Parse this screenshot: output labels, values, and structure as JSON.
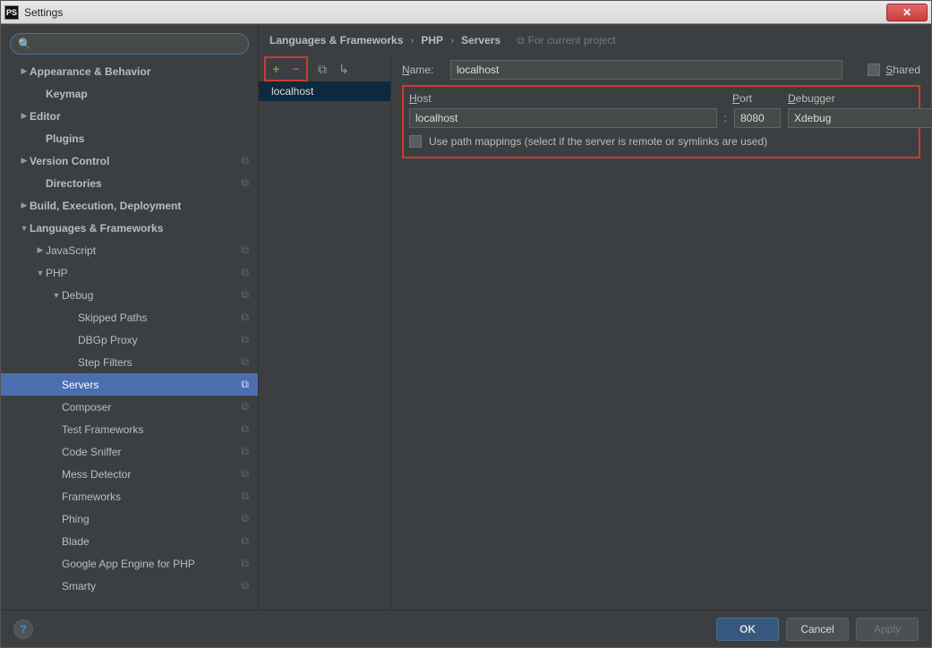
{
  "window": {
    "title": "Settings",
    "app_icon_text": "PS",
    "close_glyph": "✕"
  },
  "search": {
    "placeholder": ""
  },
  "sidebar": {
    "items": [
      {
        "label": "Appearance & Behavior",
        "bold": true,
        "depth": 0,
        "arrow": "right",
        "copy": false
      },
      {
        "label": "Keymap",
        "bold": true,
        "depth": 1,
        "arrow": "",
        "copy": false
      },
      {
        "label": "Editor",
        "bold": true,
        "depth": 0,
        "arrow": "right",
        "copy": false
      },
      {
        "label": "Plugins",
        "bold": true,
        "depth": 1,
        "arrow": "",
        "copy": false
      },
      {
        "label": "Version Control",
        "bold": true,
        "depth": 0,
        "arrow": "right",
        "copy": true
      },
      {
        "label": "Directories",
        "bold": true,
        "depth": 1,
        "arrow": "",
        "copy": true
      },
      {
        "label": "Build, Execution, Deployment",
        "bold": true,
        "depth": 0,
        "arrow": "right",
        "copy": false
      },
      {
        "label": "Languages & Frameworks",
        "bold": true,
        "depth": 0,
        "arrow": "down",
        "copy": false
      },
      {
        "label": "JavaScript",
        "bold": false,
        "depth": 1,
        "arrow": "right",
        "copy": true
      },
      {
        "label": "PHP",
        "bold": false,
        "depth": 1,
        "arrow": "down",
        "copy": true
      },
      {
        "label": "Debug",
        "bold": false,
        "depth": 2,
        "arrow": "down",
        "copy": true
      },
      {
        "label": "Skipped Paths",
        "bold": false,
        "depth": 3,
        "arrow": "",
        "copy": true
      },
      {
        "label": "DBGp Proxy",
        "bold": false,
        "depth": 3,
        "arrow": "",
        "copy": true
      },
      {
        "label": "Step Filters",
        "bold": false,
        "depth": 3,
        "arrow": "",
        "copy": true
      },
      {
        "label": "Servers",
        "bold": false,
        "depth": 2,
        "arrow": "",
        "copy": true,
        "selected": true
      },
      {
        "label": "Composer",
        "bold": false,
        "depth": 2,
        "arrow": "",
        "copy": true
      },
      {
        "label": "Test Frameworks",
        "bold": false,
        "depth": 2,
        "arrow": "",
        "copy": true
      },
      {
        "label": "Code Sniffer",
        "bold": false,
        "depth": 2,
        "arrow": "",
        "copy": true
      },
      {
        "label": "Mess Detector",
        "bold": false,
        "depth": 2,
        "arrow": "",
        "copy": true
      },
      {
        "label": "Frameworks",
        "bold": false,
        "depth": 2,
        "arrow": "",
        "copy": true
      },
      {
        "label": "Phing",
        "bold": false,
        "depth": 2,
        "arrow": "",
        "copy": true
      },
      {
        "label": "Blade",
        "bold": false,
        "depth": 2,
        "arrow": "",
        "copy": true
      },
      {
        "label": "Google App Engine for PHP",
        "bold": false,
        "depth": 2,
        "arrow": "",
        "copy": true
      },
      {
        "label": "Smarty",
        "bold": false,
        "depth": 2,
        "arrow": "",
        "copy": true
      }
    ]
  },
  "breadcrumb": {
    "parts": [
      "Languages & Frameworks",
      "PHP",
      "Servers"
    ],
    "sep": "›",
    "project_hint": "For current project",
    "copy_glyph": "⧉"
  },
  "toolbar": {
    "add_glyph": "+",
    "remove_glyph": "−",
    "copy_glyph": "⧉",
    "import_glyph": "↳"
  },
  "server_list": {
    "items": [
      "localhost"
    ]
  },
  "form": {
    "name_label": "Name:",
    "name_value": "localhost",
    "shared_label": "Shared",
    "host_label": "Host",
    "host_value": "localhost",
    "port_label": "Port",
    "port_value": "8080",
    "colon": ":",
    "debugger_label": "Debugger",
    "debugger_value": "Xdebug",
    "mapping_label": "Use path mappings (select if the server is remote or symlinks are used)"
  },
  "buttons": {
    "help": "?",
    "ok": "OK",
    "cancel": "Cancel",
    "apply": "Apply"
  }
}
